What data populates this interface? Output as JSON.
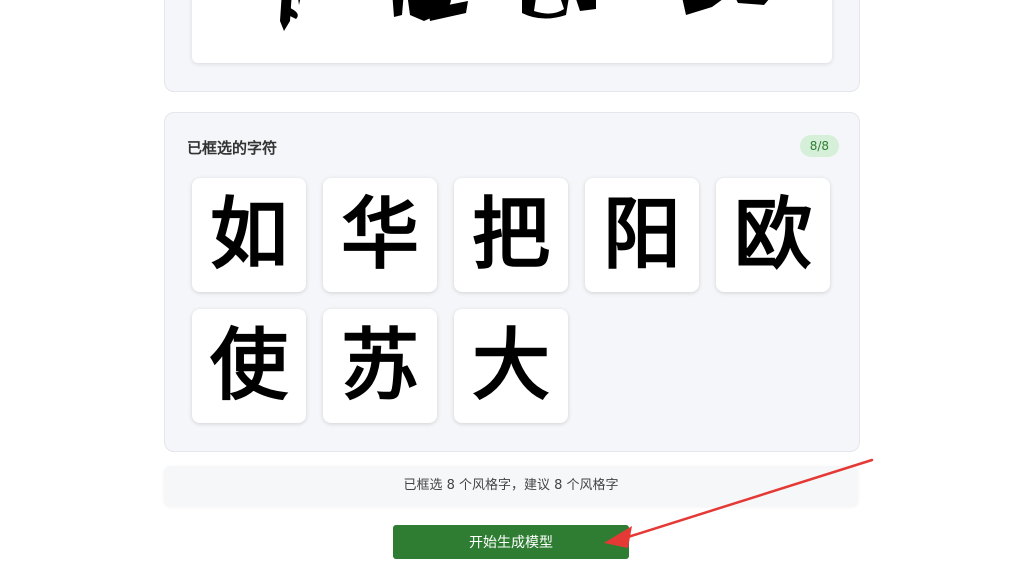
{
  "top_preview": {
    "glyphs": [
      "阳",
      "欧",
      "苏"
    ]
  },
  "selected_panel": {
    "title": "已框选的字符",
    "count_badge": "8/8",
    "characters": [
      "如",
      "华",
      "把",
      "阳",
      "欧",
      "使",
      "苏",
      "大"
    ]
  },
  "summary": {
    "text": "已框选 8 个风格字，建议 8 个风格字"
  },
  "actions": {
    "start_label": "开始生成模型"
  },
  "annotation": {
    "arrow_color": "#e53935"
  }
}
